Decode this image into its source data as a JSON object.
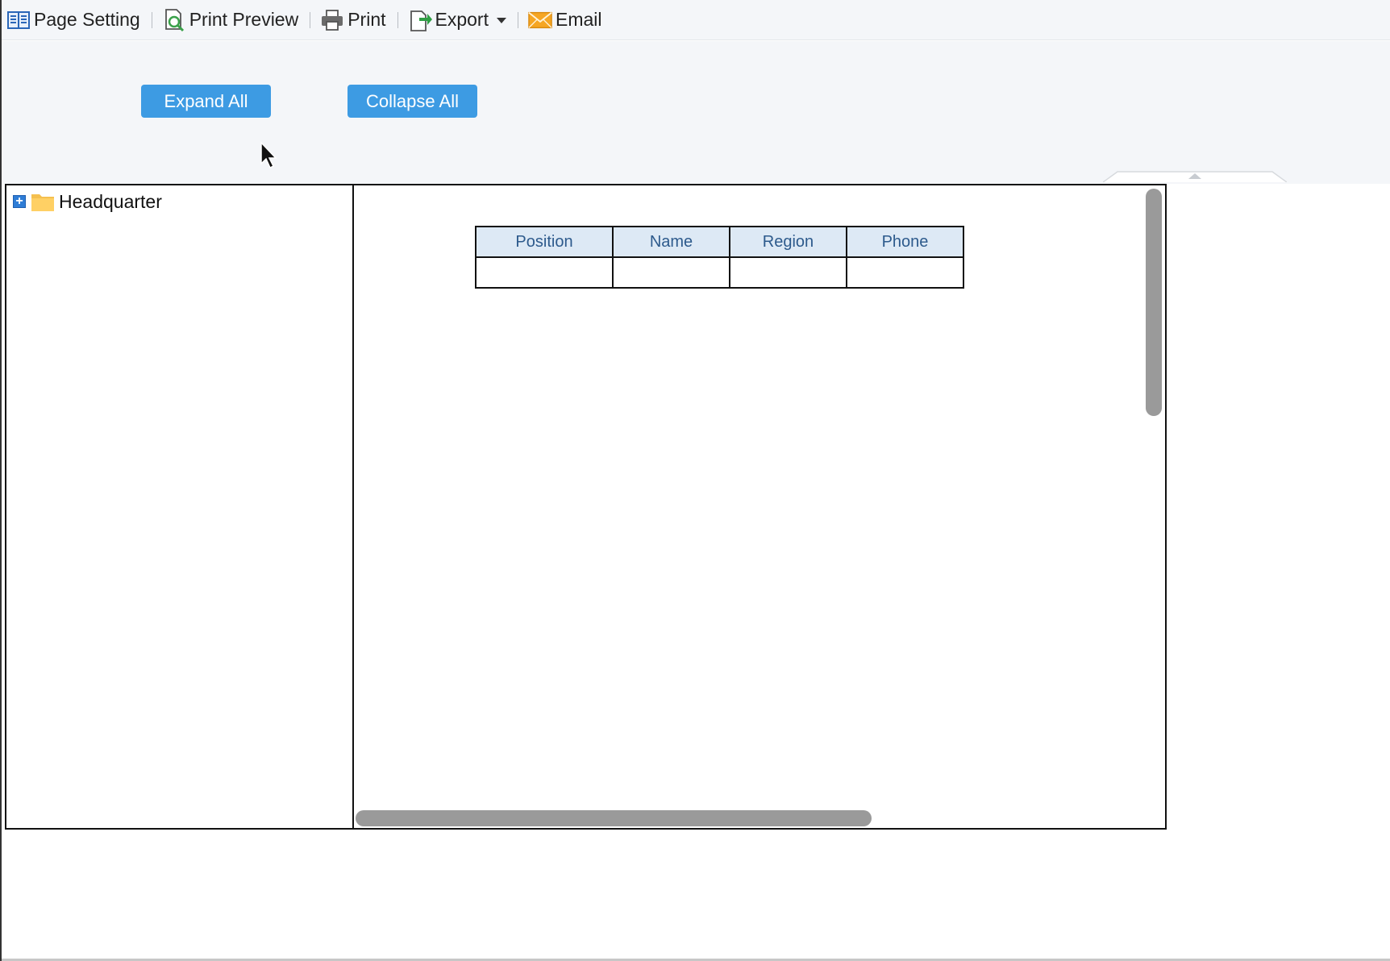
{
  "toolbar": {
    "items": [
      {
        "label": "Page Setting",
        "icon": "page-setting-icon"
      },
      {
        "label": "Print Preview",
        "icon": "print-preview-icon"
      },
      {
        "label": "Print",
        "icon": "printer-icon"
      },
      {
        "label": "Export",
        "icon": "export-icon"
      },
      {
        "label": "Email",
        "icon": "email-icon"
      }
    ]
  },
  "actions": {
    "expand_all": "Expand All",
    "collapse_all": "Collapse All"
  },
  "tree": {
    "root_label": "Headquarter",
    "root_icon": "folder-icon",
    "expand_icon": "plus-icon"
  },
  "table": {
    "columns": [
      "Position",
      "Name",
      "Region",
      "Phone"
    ],
    "rows": [
      [
        "",
        "",
        "",
        ""
      ]
    ]
  },
  "colors": {
    "button": "#3d9be3",
    "header_bg": "#dde9f5",
    "header_text": "#2d5a8c",
    "toolbar_bg": "#f4f6f9",
    "scrollbar": "#9a9a9a"
  }
}
